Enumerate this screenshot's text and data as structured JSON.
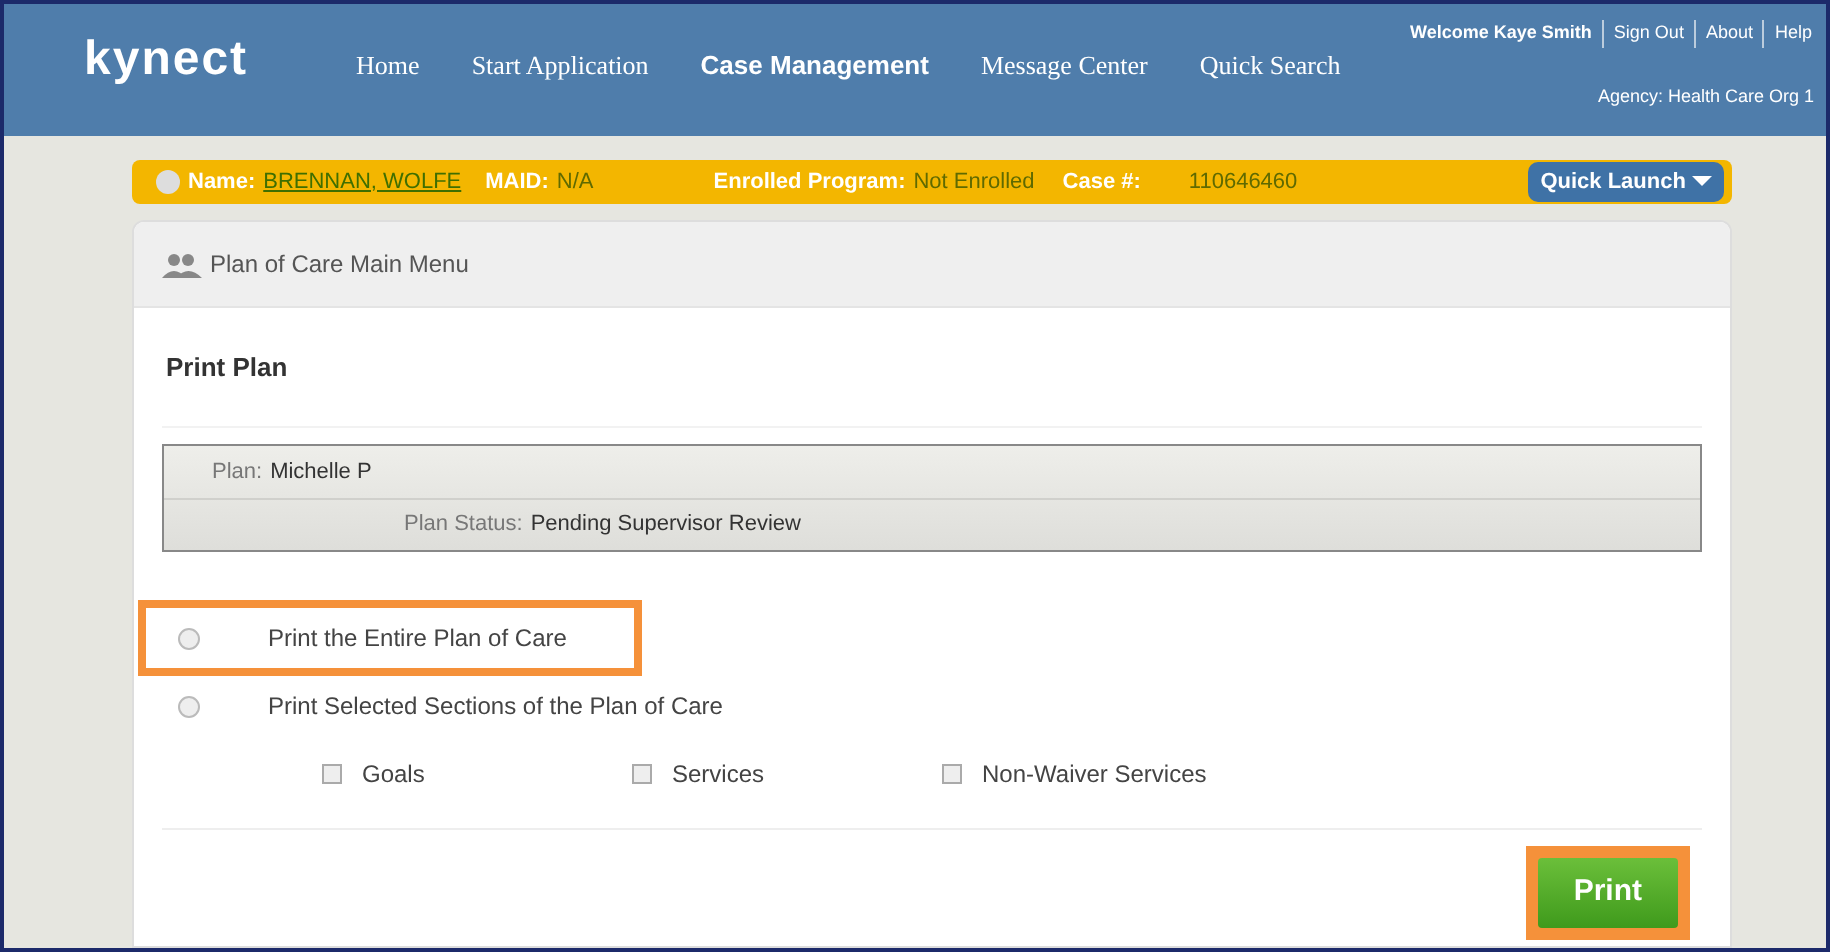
{
  "header": {
    "logo": "kynect",
    "nav": [
      {
        "label": "Home",
        "selected": false
      },
      {
        "label": "Start Application",
        "selected": false
      },
      {
        "label": "Case Management",
        "selected": true
      },
      {
        "label": "Message Center",
        "selected": false
      },
      {
        "label": "Quick Search",
        "selected": false
      }
    ],
    "welcome": "Welcome Kaye Smith",
    "links": [
      "Sign Out",
      "About",
      "Help"
    ],
    "agency": "Agency: Health Care Org 1"
  },
  "case_bar": {
    "fields": [
      {
        "label": "Name:",
        "value": "BRENNAN, WOLFE",
        "kind": "link"
      },
      {
        "label": "MAID:",
        "value": "N/A",
        "kind": "text"
      },
      {
        "label": "Enrolled Program:",
        "value": "Not Enrolled",
        "kind": "text"
      },
      {
        "label": "Case #:",
        "value": "110646460",
        "kind": "text"
      }
    ],
    "quick_launch": "Quick Launch"
  },
  "panel": {
    "title": "Plan of Care Main Menu",
    "section": "Print Plan",
    "plan": {
      "label": "Plan:",
      "value": "Michelle P"
    },
    "status": {
      "label": "Plan Status:",
      "value": "Pending Supervisor Review"
    },
    "options": [
      {
        "label": "Print the Entire Plan of Care",
        "selected": false,
        "highlighted": true
      },
      {
        "label": "Print Selected Sections of the Plan of Care",
        "selected": false,
        "highlighted": false
      }
    ],
    "sections": [
      {
        "label": "Goals",
        "checked": false
      },
      {
        "label": "Services",
        "checked": false
      },
      {
        "label": "Non-Waiver Services",
        "checked": false
      }
    ],
    "print_button": {
      "label": "Print",
      "highlighted": true
    }
  }
}
